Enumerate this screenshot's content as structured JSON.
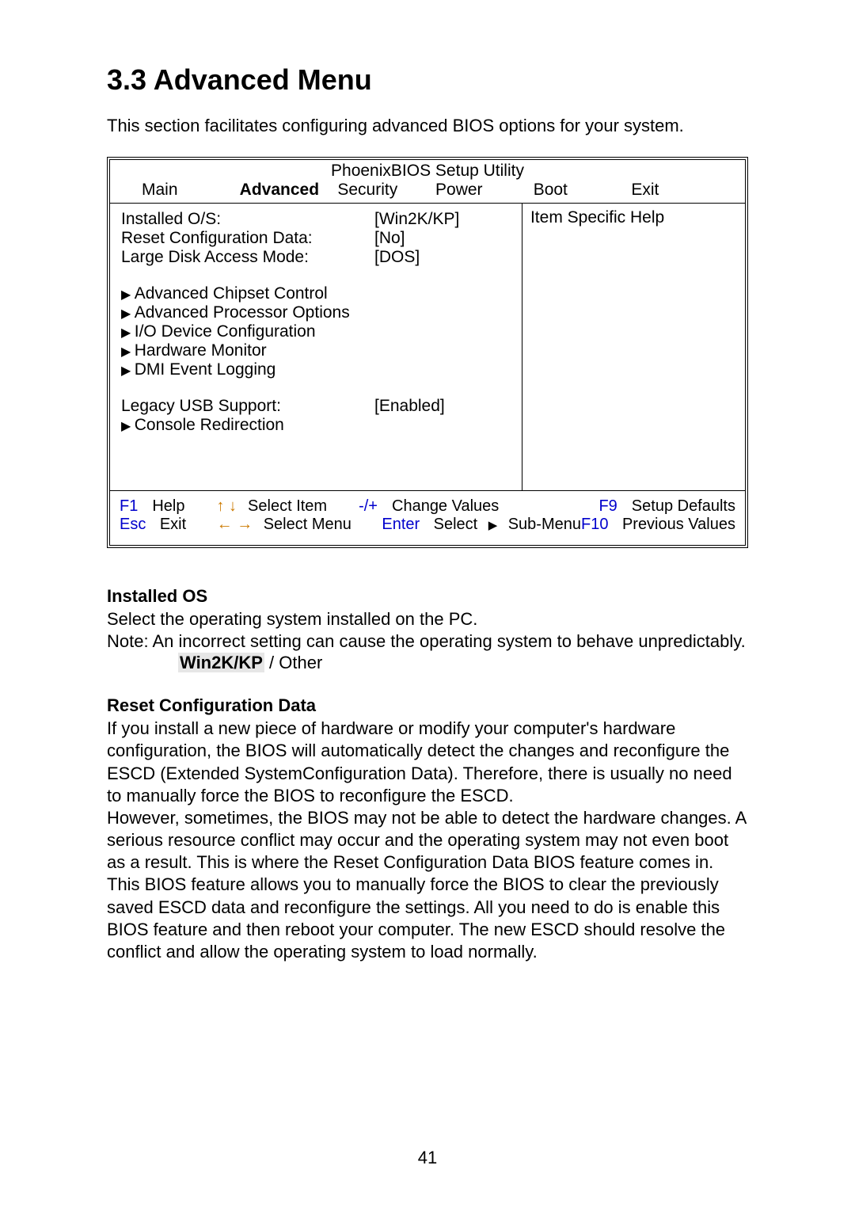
{
  "heading": "3.3 Advanced Menu",
  "intro": "This section facilitates configuring advanced BIOS options for your system.",
  "bios": {
    "title": "PhoenixBIOS Setup Utility",
    "tabs": [
      "Main",
      "Advanced",
      "Security",
      "Power",
      "Boot",
      "Exit"
    ],
    "active_tab": "Advanced",
    "help_title": "Item Specific Help",
    "options": {
      "installed_os": {
        "label": "Installed O/S:",
        "value": "[Win2K/KP]"
      },
      "reset_config": {
        "label": "Reset Configuration Data:",
        "value": "[No]"
      },
      "large_disk": {
        "label": "Large Disk Access Mode:",
        "value": "[DOS]"
      },
      "legacy_usb": {
        "label": "Legacy USB Support:",
        "value": "[Enabled]"
      }
    },
    "submenus": [
      "Advanced Chipset Control",
      "Advanced Processor Options",
      "I/O Device Configuration",
      "Hardware Monitor",
      "DMI Event Logging"
    ],
    "submenus2": [
      "Console Redirection"
    ],
    "footer": {
      "f1": "F1",
      "help": "Help",
      "updown": "↑  ↓",
      "select_item": "Select Item",
      "pm": "-/+",
      "change_values": "Change Values",
      "f9": "F9",
      "setup_defaults": "Setup Defaults",
      "esc": "Esc",
      "exit": "Exit",
      "lr": "← →",
      "select_menu": "Select Menu",
      "enter": "Enter",
      "select": "Select",
      "submenu": "Sub-Menu",
      "f10": "F10",
      "prev_values": "Previous Values"
    }
  },
  "desc": {
    "installed_os": {
      "title": "Installed OS",
      "p1": "Select the operating system installed on the PC.",
      "p2": "Note: An incorrect setting can cause the operating system to behave unpredictably.",
      "opt_default": "Win2K/KP",
      "opt_sep": " / ",
      "opt_other": "Other"
    },
    "reset_config": {
      "title": "Reset Configuration Data",
      "p1": "If you install a new piece of hardware or modify your computer's hardware configuration, the BIOS will automatically detect the changes and reconfigure the ESCD (Extended SystemConfiguration Data). Therefore, there is usually no need to manually force the BIOS to reconfigure the ESCD.",
      "p2": "However, sometimes, the BIOS may not be able to detect the hardware changes. A serious resource conflict may occur and the operating system may not even boot as a result. This is where the Reset Configuration Data BIOS feature comes in.",
      "p3": "This BIOS feature allows you to manually force the BIOS to clear the previously saved ESCD data and reconfigure the settings. All you need to do is enable this BIOS feature and then reboot your computer. The new ESCD should resolve the conflict and allow the operating system to load normally."
    }
  },
  "page_number": "41"
}
